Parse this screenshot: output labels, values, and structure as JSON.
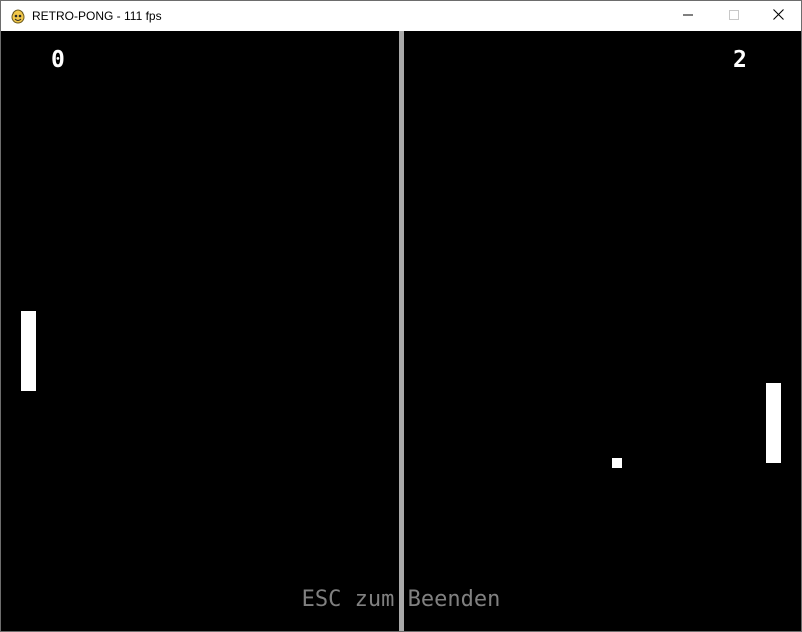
{
  "window": {
    "title": "RETRO-PONG - 111 fps",
    "app_icon": "pygame-snake-icon",
    "controls": {
      "minimize_icon": "minimize-icon",
      "maximize_icon": "maximize-icon",
      "close_icon": "close-icon"
    }
  },
  "game": {
    "background_color": "#000000",
    "net_color": "#a9a9a9",
    "score_left": "0",
    "score_right": "2",
    "hint_text": "ESC zum Beenden",
    "hint_color": "#808080"
  }
}
